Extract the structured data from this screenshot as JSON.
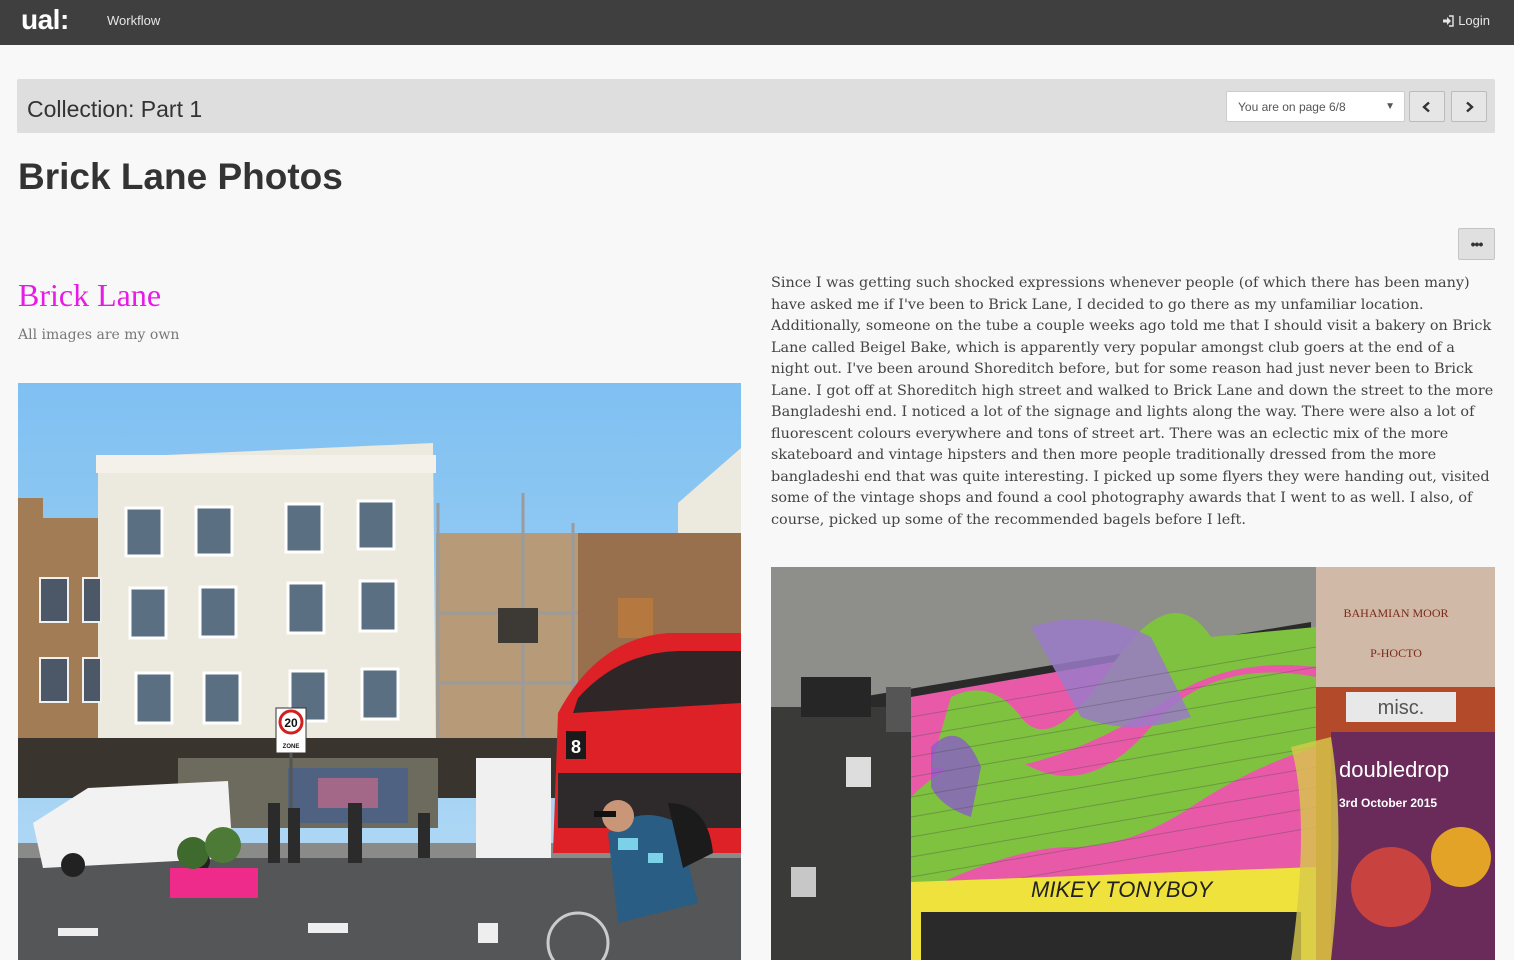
{
  "navbar": {
    "logo": "ual:",
    "workflow_label": "Workflow",
    "login_label": "Login",
    "login_icon": "sign-in-icon"
  },
  "collection": {
    "title": "Collection: Part 1",
    "page_select_value": "You are on page 6/8",
    "prev_icon": "chevron-left-icon",
    "next_icon": "chevron-right-icon"
  },
  "page": {
    "title": "Brick Lane Photos",
    "more_label": "•••"
  },
  "section": {
    "title": "Brick Lane",
    "subtitle": "All images are my own",
    "title_color": "#e61be6"
  },
  "body_text": "Since I was getting such shocked expressions whenever people (of which there has been many) have asked me if I've been to Brick Lane, I decided to go there as my unfamiliar location. Additionally, someone on the tube a couple weeks ago told me that I should visit a bakery on Brick Lane called Beigel Bake, which is apparently very popular amongst club goers at the end of a night out. I've been around Shoreditch before, but for some reason had just never been to Brick Lane. I got off at Shoreditch high street and walked to Brick Lane and down the street to the more Bangladeshi end. I noticed a lot of the signage and lights along the way. There were also a lot of fluorescent colours everywhere and tons of street art. There was an eclectic mix of the more skateboard and vintage hipsters and then more people traditionally dressed from the more bangladeshi end that was quite interesting. I picked up some flyers they were handing out, visited some of the vintage shops and found a cool photography awards that I went to as well. I also, of course, picked up some of the recommended bagels before I left.",
  "photos": {
    "street": {
      "bus_route": "8",
      "speed_sign": "20",
      "speed_sign_sub": "ZONE"
    },
    "graffiti": {
      "tag_text": "MIKEY  TONYBOY",
      "poster_brand": "doubledrop",
      "poster_date": "3rd October 2015",
      "poster_top_1": "BAHAMIAN MOOR",
      "poster_top_2": "P-HOCTO",
      "poster_misc": "misc."
    }
  }
}
